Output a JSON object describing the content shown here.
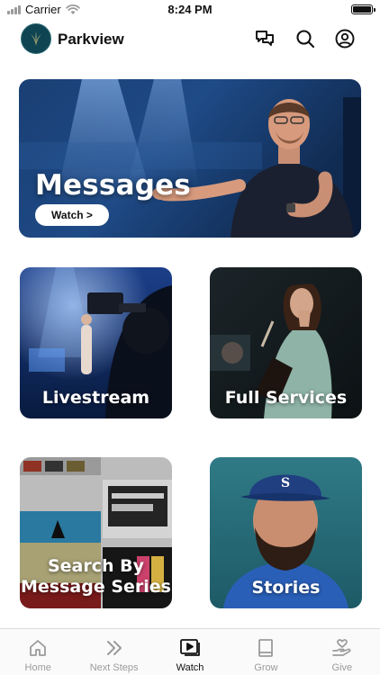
{
  "status_bar": {
    "carrier": "Carrier",
    "time": "8:24 PM",
    "icons": [
      "signal-icon",
      "wifi-icon",
      "battery-icon"
    ]
  },
  "header": {
    "title": "Parkview",
    "logo_icon": "parkview-logo-icon",
    "actions": [
      "chat-icon",
      "search-icon",
      "account-icon"
    ]
  },
  "hero": {
    "title": "Messages",
    "button_label": "Watch >"
  },
  "tiles": [
    {
      "label": "Livestream"
    },
    {
      "label": "Full Services"
    },
    {
      "label_line1": "Search By",
      "label_line2": "Message Series"
    },
    {
      "label": "Stories"
    }
  ],
  "tab_bar": {
    "active": "Watch",
    "tabs": [
      {
        "label": "Home",
        "icon": "home-icon"
      },
      {
        "label": "Next Steps",
        "icon": "double-chevron-icon"
      },
      {
        "label": "Watch",
        "icon": "play-icon"
      },
      {
        "label": "Grow",
        "icon": "book-icon"
      },
      {
        "label": "Give",
        "icon": "heart-hand-icon"
      }
    ]
  },
  "colors": {
    "accent": "#111111",
    "tab_inactive": "#9b9b9b",
    "logo_bg": "#0f4552"
  }
}
